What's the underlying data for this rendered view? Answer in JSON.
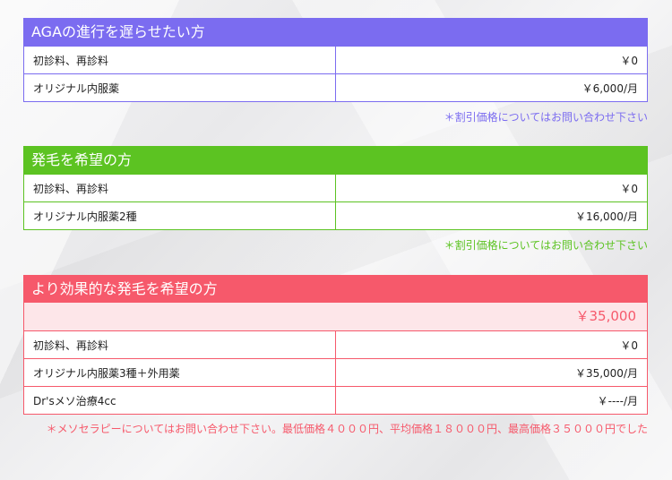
{
  "colors": {
    "purple": "#7b6cf0",
    "green": "#5cc322",
    "red": "#f6596b",
    "red_light": "#fde6e9"
  },
  "plans": [
    {
      "title": "AGAの進行を遅らせたい方",
      "rows": [
        {
          "label": "初診料、再診料",
          "price": "￥0"
        },
        {
          "label": "オリジナル内服薬",
          "price": "￥6,000/月"
        }
      ],
      "note": "＊割引価格についてはお問い合わせ下さい"
    },
    {
      "title": "発毛を希望の方",
      "rows": [
        {
          "label": "初診料、再診料",
          "price": "￥0"
        },
        {
          "label": "オリジナル内服薬2種",
          "price": "￥16,000/月"
        }
      ],
      "note": "＊割引価格についてはお問い合わせ下さい"
    },
    {
      "title": "より効果的な発毛を希望の方",
      "total": "￥35,000",
      "rows": [
        {
          "label": "初診料、再診料",
          "price": "￥0"
        },
        {
          "label": "オリジナル内服薬3種＋外用薬",
          "price": "￥35,000/月"
        },
        {
          "label": "Dr'sメソ治療4cc",
          "price": "￥----/月"
        }
      ],
      "note": "＊メソセラピーについてはお問い合わせ下さい。最低価格４０００円、平均価格１８０００円、最高価格３５０００円でした"
    }
  ]
}
